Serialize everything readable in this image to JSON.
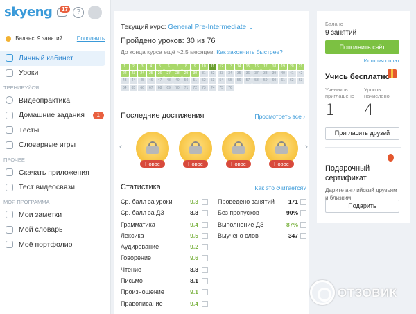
{
  "header": {
    "logo": "skyeng",
    "messages_count": "17"
  },
  "sidebar": {
    "balance_text": "Баланс: 9 занятий",
    "topup_link": "Пополнить",
    "main_items": [
      {
        "label": "Личный кабинет",
        "active": true
      },
      {
        "label": "Уроки"
      }
    ],
    "section_training": "Тренируйся",
    "training_items": [
      {
        "label": "Видеопрактика"
      },
      {
        "label": "Домашние задания",
        "badge": "1"
      },
      {
        "label": "Тесты"
      },
      {
        "label": "Словарные игры"
      }
    ],
    "section_other": "Прочее",
    "other_items": [
      {
        "label": "Скачать приложения"
      },
      {
        "label": "Тест видеосвязи"
      }
    ],
    "section_program": "Моя программа",
    "program_items": [
      {
        "label": "Мои заметки"
      },
      {
        "label": "Мой словарь"
      },
      {
        "label": "Моё портфолио"
      }
    ]
  },
  "main": {
    "course_label": "Текущий курс:",
    "course_name": "General Pre-Intermediate",
    "lessons_done": "Пройдено уроков: 30 из 76",
    "remaining": "До конца курса ещё ~2.5 месяцев.",
    "faster_link": "Как закончить быстрее?",
    "lessons_total": 76,
    "lessons_completed": 30,
    "achievements_title": "Последние достижения",
    "view_all": "Просмотреть все ›",
    "achievements": [
      {
        "label": "Новое"
      },
      {
        "label": "Новое"
      },
      {
        "label": "Новое"
      },
      {
        "label": "Новое"
      }
    ],
    "stats_title": "Статистика",
    "stats_link": "Как это считается?",
    "stats_left": [
      {
        "label": "Ср. балл за уроки",
        "value": "9.3",
        "green": true
      },
      {
        "label": "Ср. балл за ДЗ",
        "value": "8.8",
        "green": false
      },
      {
        "label": "Грамматика",
        "value": "9.4",
        "green": true
      },
      {
        "label": "Лексика",
        "value": "9.5",
        "green": true
      },
      {
        "label": "Аудирование",
        "value": "9.2",
        "green": true
      },
      {
        "label": "Говорение",
        "value": "9.6",
        "green": true
      },
      {
        "label": "Чтение",
        "value": "8.8",
        "green": false
      },
      {
        "label": "Письмо",
        "value": "8.1",
        "green": false
      },
      {
        "label": "Произношение",
        "value": "9.1",
        "green": true
      },
      {
        "label": "Правописание",
        "value": "9.4",
        "green": true
      }
    ],
    "stats_right": [
      {
        "label": "Проведено занятий",
        "value": "171",
        "green": false
      },
      {
        "label": "Без пропусков",
        "value": "90%",
        "green": false
      },
      {
        "label": "Выполнение ДЗ",
        "value": "87%",
        "green": true
      },
      {
        "label": "Выучено слов",
        "value": "347",
        "green": false
      }
    ]
  },
  "right": {
    "balance_label": "Баланс",
    "balance_value": "9 занятий",
    "topup_button": "Пополнить счёт",
    "payment_history": "История оплат",
    "learn_free": "Учись бесплатно",
    "invited_label": "Учеников приглашено",
    "invited_value": "1",
    "accrued_label": "Уроков начислено",
    "accrued_value": "4",
    "invite_button": "Пригласить друзей",
    "certificate_title": "Подарочный сертификат",
    "certificate_desc": "Дарите английский друзьям и близким",
    "gift_button": "Подарить"
  },
  "watermark": "ОТЗОВИК",
  "colors": {
    "accent": "#3a9ad9",
    "green": "#7cc142",
    "badge": "#e9603f"
  }
}
